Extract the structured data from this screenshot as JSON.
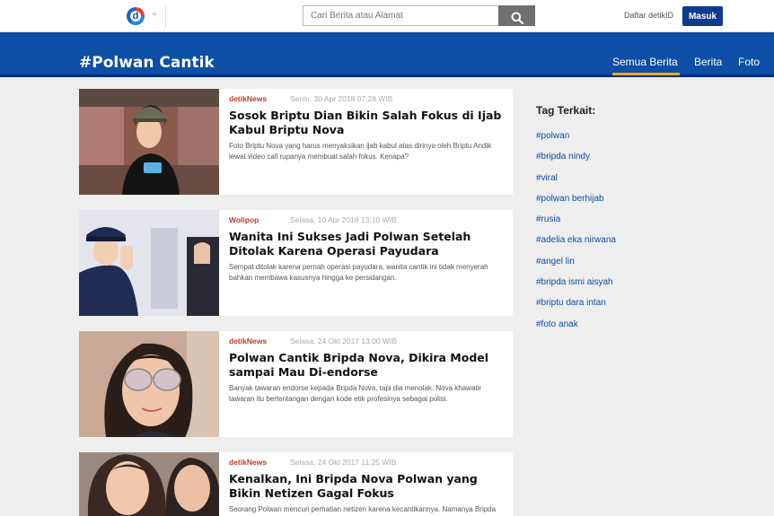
{
  "topbar": {
    "logo_letter": "d",
    "search_placeholder": "Cari Berita atau Alamat",
    "daftar_label": "Daftar detikID",
    "masuk_label": "Masuk"
  },
  "header": {
    "title": "#Polwan Cantik",
    "nav": [
      "Semua Berita",
      "Berita",
      "Foto"
    ]
  },
  "articles": [
    {
      "source": "detikNews",
      "date": "Senin, 30 Apr 2018 07:28 WIB",
      "title": "Sosok Briptu Dian Bikin Salah Fokus di Ijab Kabul Briptu Nova",
      "desc": "Foto Briptu Nova yang harus menyaksikan ijab kabul atas dirinya oleh Briptu Andik lewat video call rupanya membuat salah fokus. Kenapa?"
    },
    {
      "source": "Wolipop",
      "date": "Selasa, 10 Apr 2018 13:10 WIB",
      "title": "Wanita Ini Sukses Jadi Polwan Setelah Ditolak Karena Operasi Payudara",
      "desc": "Sempat ditolak karena pernah operasi payudara, wanita cantik ini tidak menyerah bahkan membawa kasusnya hingga ke persidangan."
    },
    {
      "source": "detikNews",
      "date": "Selasa, 24 Okt 2017 13:00 WIB",
      "title": "Polwan Cantik Bripda Nova, Dikira Model sampai Mau Di-endorse",
      "desc": "Banyak tawaran endorse kepada Bripda Nova, tapi dia menolak. Nova khawatir tawaran itu bertentangan dengan kode etik profesinya sebagai polisi."
    },
    {
      "source": "detikNews",
      "date": "Selasa, 24 Okt 2017 11:25 WIB",
      "title": "Kenalkan, Ini Bripda Nova Polwan yang Bikin Netizen Gagal Fokus",
      "desc": "Seorang Polwan mencuri perhatian netizen karena kecantikannya. Namanya Bripda Nova Sundari, Polwan Polres Rejang Lebong, Bengkulu. Bagaimana"
    }
  ],
  "sidebar": {
    "title": "Tag Terkait:",
    "tags": [
      "#polwan",
      "#bripda nindy",
      "#viral",
      "#polwan berhijab",
      "#rusia",
      "#adelia eka nirwana",
      "#angel lin",
      "#bripda ismi aisyah",
      "#briptu dara intan",
      "#foto anak"
    ]
  },
  "colors": {
    "brand_blue": "#0d4ea6",
    "source_red": "#c0392b",
    "nav_active": "#f5a623"
  }
}
